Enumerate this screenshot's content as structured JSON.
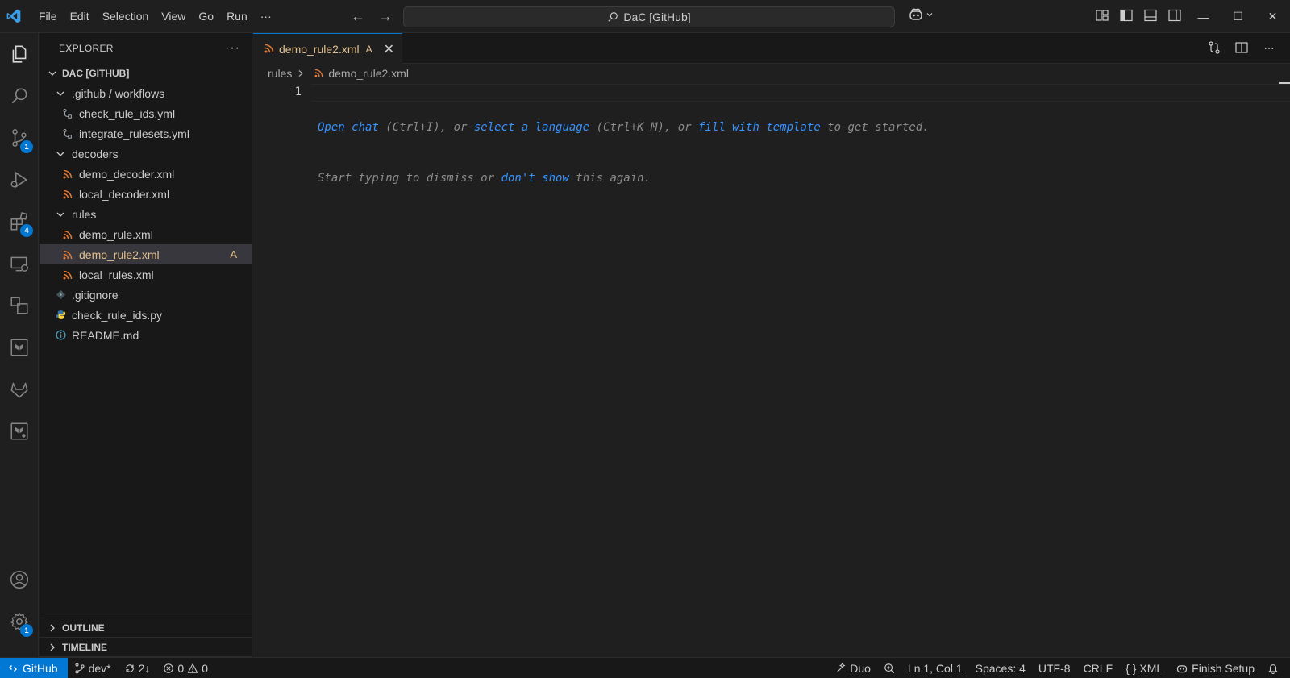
{
  "window": {
    "title": "DaC [GitHub]",
    "menu": [
      "File",
      "Edit",
      "Selection",
      "View",
      "Go",
      "Run",
      "···"
    ]
  },
  "activity_bar": {
    "scm_badge": "1",
    "extensions_badge": "4",
    "settings_badge": "1"
  },
  "sidebar": {
    "header": "EXPLORER",
    "more": "···",
    "root": "DAC [GITHUB]",
    "tree": [
      {
        "label": ".github / workflows",
        "type": "folder",
        "depth": 1
      },
      {
        "label": "check_rule_ids.yml",
        "type": "workflow",
        "depth": 2
      },
      {
        "label": "integrate_rulesets.yml",
        "type": "workflow",
        "depth": 2
      },
      {
        "label": "decoders",
        "type": "folder",
        "depth": 1
      },
      {
        "label": "demo_decoder.xml",
        "type": "xml",
        "depth": 2
      },
      {
        "label": "local_decoder.xml",
        "type": "xml",
        "depth": 2
      },
      {
        "label": "rules",
        "type": "folder",
        "depth": 1
      },
      {
        "label": "demo_rule.xml",
        "type": "xml",
        "depth": 2
      },
      {
        "label": "demo_rule2.xml",
        "type": "xml",
        "depth": 2,
        "status": "A",
        "selected": true
      },
      {
        "label": "local_rules.xml",
        "type": "xml",
        "depth": 2
      },
      {
        "label": ".gitignore",
        "type": "git",
        "depth": 1
      },
      {
        "label": "check_rule_ids.py",
        "type": "python",
        "depth": 1
      },
      {
        "label": "README.md",
        "type": "info",
        "depth": 1
      }
    ],
    "outline": "OUTLINE",
    "timeline": "TIMELINE"
  },
  "editor": {
    "tab": {
      "label": "demo_rule2.xml",
      "status": "A"
    },
    "breadcrumb": [
      "rules",
      "demo_rule2.xml"
    ],
    "line_number": "1",
    "hint_line1": [
      {
        "text": "Open chat",
        "link": true
      },
      {
        "text": " (Ctrl+I), or ",
        "link": false
      },
      {
        "text": "select a language",
        "link": true
      },
      {
        "text": " (Ctrl+K M), or ",
        "link": false
      },
      {
        "text": "fill with template",
        "link": true
      },
      {
        "text": " to get started.",
        "link": false
      }
    ],
    "hint_line2": [
      {
        "text": "Start typing to dismiss or ",
        "link": false
      },
      {
        "text": "don't show",
        "link": true
      },
      {
        "text": " this again.",
        "link": false
      }
    ]
  },
  "statusbar": {
    "remote": "GitHub",
    "branch": "dev*",
    "sync": "2↓",
    "errors": "0",
    "warnings": "0",
    "duo": "Duo",
    "position": "Ln 1, Col 1",
    "spaces": "Spaces: 4",
    "encoding": "UTF-8",
    "eol": "CRLF",
    "language": "XML",
    "finish_setup": "Finish Setup"
  },
  "colors": {
    "accent": "#0078d4",
    "modified": "#e2c08d",
    "link": "#3794ff"
  }
}
